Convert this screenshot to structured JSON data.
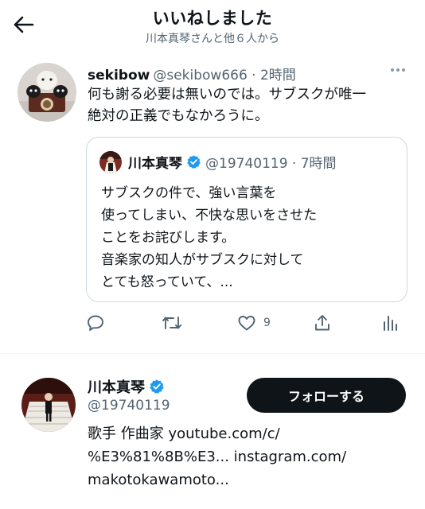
{
  "header": {
    "title": "いいねしました",
    "subtitle": "川本真琴さんと他６人から"
  },
  "tweet": {
    "name": "sekibow",
    "handle": "@sekibow666 · 2時間",
    "text_lines": [
      "何も謝る必要は無いのでは。サブスクが唯一",
      "絶対の正義でもなかろうに。"
    ],
    "quote": {
      "name": "川本真琴",
      "handle": "@19740119 · 7時間",
      "text_lines": [
        "サブスクの件で、強い言葉を",
        "使ってしまい、不快な思いをさせた",
        "ことをお詫びします。",
        "音楽家の知人がサブスクに対して",
        "とても怒っていて、..."
      ]
    },
    "actions": {
      "like_count": "9"
    }
  },
  "profile": {
    "name": "川本真琴",
    "handle": "@19740119",
    "follow_label": "フォローする",
    "bio_lines": [
      "歌手 作曲家 youtube.com/c/",
      "%E3%81%8B%E3... instagram.com/",
      "makotokawamoto..."
    ]
  },
  "colors": {
    "verified": "#1d9bf0",
    "secondary_text": "#536471",
    "follow_button": "#0f1419"
  }
}
